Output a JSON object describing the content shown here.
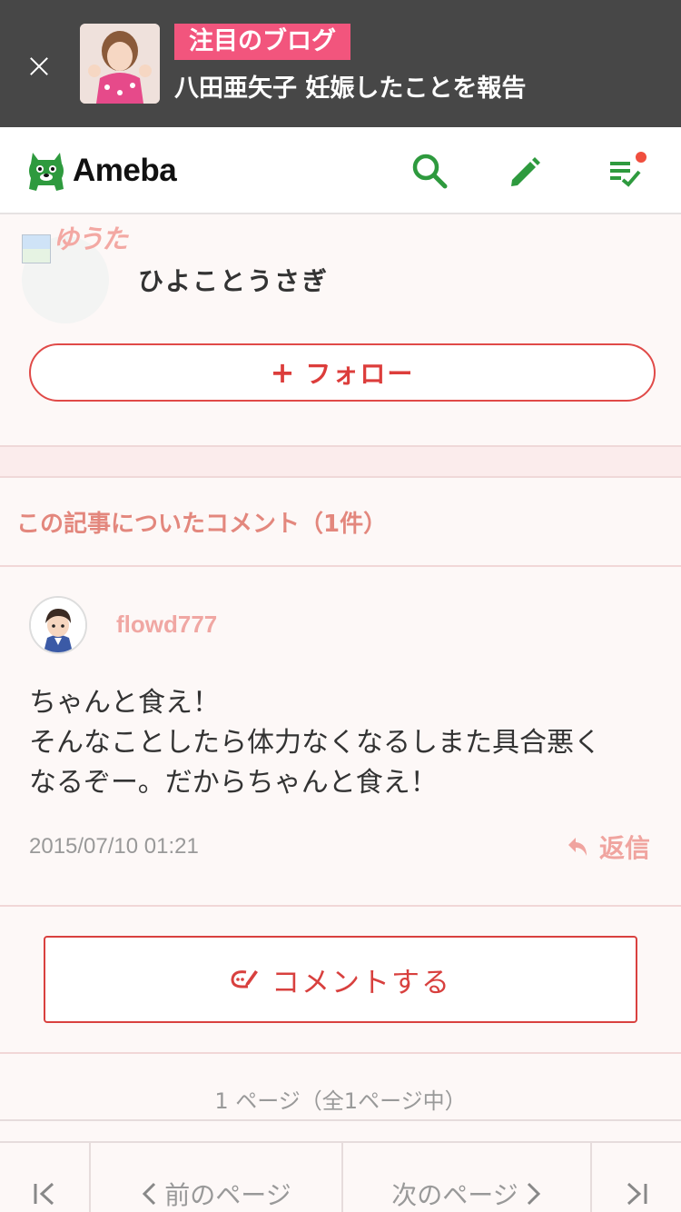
{
  "promo": {
    "badge": "注目のブログ",
    "headline": "八田亜矢子 妊娠したことを報告"
  },
  "header": {
    "logo_text": "Ameba"
  },
  "profile": {
    "blog_logo_text": "ゆうた",
    "blogger_name": "ひよことうさぎ",
    "follow_label": "フォロー"
  },
  "comments_section": {
    "title": "この記事についたコメント（1件）",
    "items": [
      {
        "author": "flowd777",
        "lines": [
          "ちゃんと食え！",
          "そんなことしたら体力なくなるしまた具合悪く",
          "なるぞー。だからちゃんと食え！"
        ],
        "date": "2015/07/10 01:21",
        "reply_label": "返信"
      }
    ]
  },
  "comment_button_label": "コメントする",
  "page_count": "1 ページ（全1ページ中）",
  "pager": {
    "prev_label": "前のページ",
    "next_label": "次のページ"
  },
  "colors": {
    "banner_bg": "#474747",
    "badge_pink": "#f2557d",
    "ameba_green": "#2e9a3e",
    "accent_red": "#d9413f",
    "notification_dot": "#f04e3e"
  },
  "icons": [
    "close-icon",
    "ameba-mascot-icon",
    "search-icon",
    "pencil-icon",
    "feed-check-icon",
    "reply-icon",
    "comment-pen-icon",
    "first-page-icon",
    "chevron-left-icon",
    "chevron-right-icon",
    "last-page-icon"
  ]
}
